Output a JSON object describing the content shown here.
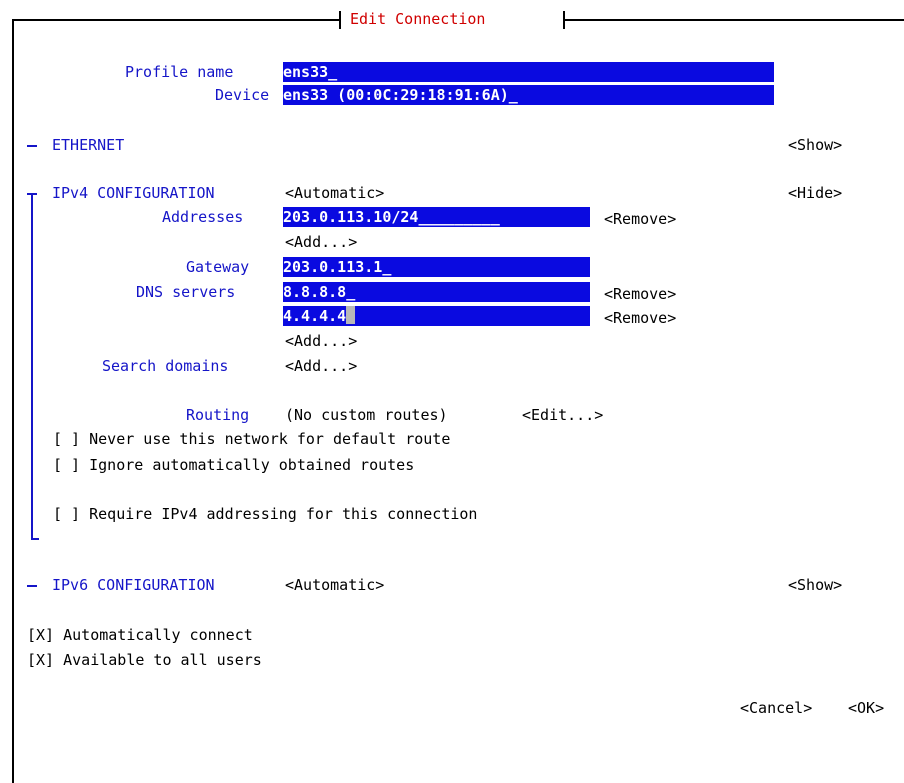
{
  "dialog": {
    "title": "Edit Connection"
  },
  "profile": {
    "profile_name_label": "Profile name",
    "profile_name_value": "ens33_",
    "device_label": "Device",
    "device_value": "ens33 (00:0C:29:18:91:6A)_"
  },
  "ethernet": {
    "label": "ETHERNET",
    "toggle": "<Show>"
  },
  "ipv4": {
    "label": "IPv4 CONFIGURATION",
    "mode": "<Automatic>",
    "toggle": "<Hide>",
    "addresses_label": "Addresses",
    "addresses": [
      {
        "value": "203.0.113.10/24",
        "remove": "<Remove>"
      }
    ],
    "add_address": "<Add...>",
    "gateway_label": "Gateway",
    "gateway_value": "203.0.113.1_",
    "dns_label": "DNS servers",
    "dns": [
      {
        "value": "8.8.8.8_",
        "remove": "<Remove>"
      },
      {
        "value": "4.4.4.4",
        "remove": "<Remove>"
      }
    ],
    "add_dns": "<Add...>",
    "search_label": "Search domains",
    "add_search": "<Add...>",
    "routing_label": "Routing",
    "routing_value": "(No custom routes)",
    "routing_edit": "<Edit...>",
    "never_default": "[ ] Never use this network for default route",
    "ignore_routes": "[ ] Ignore automatically obtained routes",
    "require_ipv4": "[ ] Require IPv4 addressing for this connection"
  },
  "ipv6": {
    "label": "IPv6 CONFIGURATION",
    "mode": "<Automatic>",
    "toggle": "<Show>"
  },
  "options": {
    "auto_connect": "[X] Automatically connect",
    "all_users": "[X] Available to all users"
  },
  "buttons": {
    "cancel": "<Cancel>",
    "ok": "<OK>"
  },
  "colors": {
    "field_bg": "#0a0ae0",
    "label_blue": "#1515c8",
    "title_red": "#d00000"
  }
}
